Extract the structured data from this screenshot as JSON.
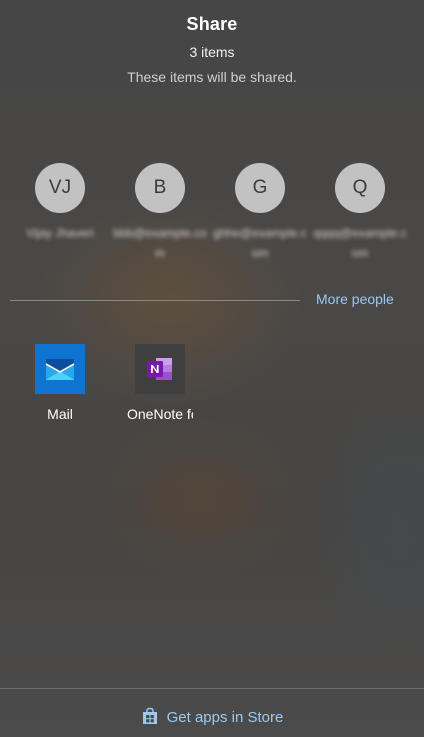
{
  "header": {
    "title": "Share",
    "count": "3 items",
    "subtitle": "These items will be shared."
  },
  "people": [
    {
      "initials": "VJ",
      "name": "Vijay Jhaveri"
    },
    {
      "initials": "B",
      "name": "bbb@example.com"
    },
    {
      "initials": "G",
      "name": "ghhe@example.com"
    },
    {
      "initials": "Q",
      "name": "qqqq@example.com"
    }
  ],
  "more_people": "More people",
  "apps": [
    {
      "label": "Mail",
      "icon": "mail-icon"
    },
    {
      "label": "OneNote for Windows",
      "icon": "onenote-icon"
    }
  ],
  "footer": {
    "store_label": "Get apps in Store",
    "icon": "store-bag-icon"
  },
  "colors": {
    "link": "#9cc8ee",
    "avatar": "#c2c2c2",
    "mail": "#0f74d1",
    "onenote": "#7719aa"
  }
}
